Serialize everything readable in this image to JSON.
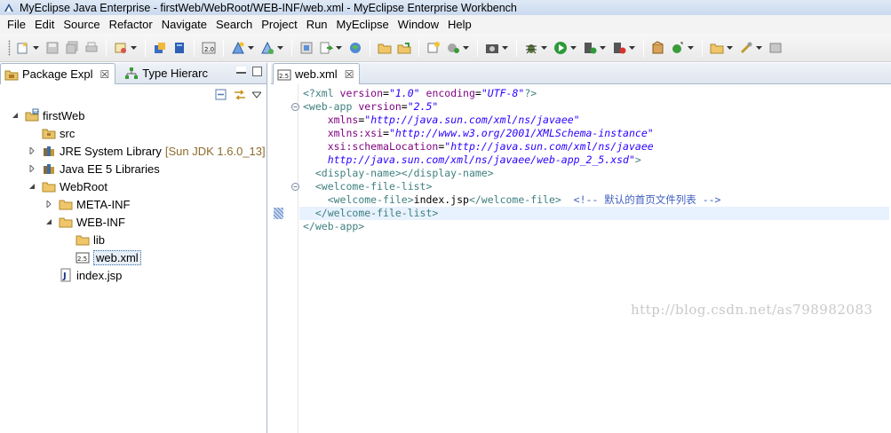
{
  "window": {
    "title": "MyEclipse Java Enterprise - firstWeb/WebRoot/WEB-INF/web.xml - MyEclipse Enterprise Workbench"
  },
  "menubar": {
    "items": [
      "File",
      "Edit",
      "Source",
      "Refactor",
      "Navigate",
      "Search",
      "Project",
      "Run",
      "MyEclipse",
      "Window",
      "Help"
    ]
  },
  "left_pane": {
    "tabs": [
      {
        "label": "Package Expl",
        "active": true
      },
      {
        "label": "Type Hierarc",
        "active": false
      }
    ],
    "close_glyph": "☒",
    "tree": [
      {
        "label": "firstWeb",
        "icon": "project-icon",
        "expanded": true
      },
      {
        "label": "src",
        "icon": "source-folder-icon"
      },
      {
        "label": "JRE System Library",
        "decoration": "[Sun JDK 1.6.0_13]",
        "icon": "library-icon",
        "expanded": false
      },
      {
        "label": "Java EE 5 Libraries",
        "icon": "library-icon",
        "expanded": false
      },
      {
        "label": "WebRoot",
        "icon": "folder-icon",
        "expanded": true
      },
      {
        "label": "META-INF",
        "icon": "folder-icon",
        "expanded": false
      },
      {
        "label": "WEB-INF",
        "icon": "folder-icon",
        "expanded": true
      },
      {
        "label": "lib",
        "icon": "folder-icon"
      },
      {
        "label": "web.xml",
        "icon": "xml-file-icon",
        "selected": true
      },
      {
        "label": "index.jsp",
        "icon": "jsp-file-icon"
      }
    ]
  },
  "editor": {
    "tab_label": "web.xml",
    "lines": [
      {
        "parts": [
          [
            "pi",
            "<?xml "
          ],
          [
            "attr",
            "version"
          ],
          [
            "text",
            "="
          ],
          [
            "val",
            "\"1.0\""
          ],
          [
            "text",
            " "
          ],
          [
            "attr",
            "encoding"
          ],
          [
            "text",
            "="
          ],
          [
            "val",
            "\"UTF-8\""
          ],
          [
            "pi",
            "?>"
          ]
        ]
      },
      {
        "parts": [
          [
            "tag",
            "<web-app "
          ],
          [
            "attr",
            "version"
          ],
          [
            "text",
            "="
          ],
          [
            "val",
            "\"2.5\""
          ]
        ]
      },
      {
        "parts": [
          [
            "text",
            "    "
          ],
          [
            "attr",
            "xmlns"
          ],
          [
            "text",
            "="
          ],
          [
            "val",
            "\"http://java.sun.com/xml/ns/javaee\""
          ]
        ]
      },
      {
        "parts": [
          [
            "text",
            "    "
          ],
          [
            "attr",
            "xmlns:xsi"
          ],
          [
            "text",
            "="
          ],
          [
            "val",
            "\"http://www.w3.org/2001/XMLSchema-instance\""
          ]
        ]
      },
      {
        "parts": [
          [
            "text",
            "    "
          ],
          [
            "attr",
            "xsi:schemaLocation"
          ],
          [
            "text",
            "="
          ],
          [
            "val",
            "\"http://java.sun.com/xml/ns/javaee"
          ]
        ]
      },
      {
        "parts": [
          [
            "text",
            "    "
          ],
          [
            "val",
            "http://java.sun.com/xml/ns/javaee/web-app_2_5.xsd\""
          ],
          [
            "tag",
            ">"
          ]
        ]
      },
      {
        "parts": [
          [
            "text",
            "  "
          ],
          [
            "tag",
            "<display-name></display-name>"
          ]
        ]
      },
      {
        "parts": [
          [
            "text",
            "  "
          ],
          [
            "tag",
            "<welcome-file-list>"
          ]
        ]
      },
      {
        "parts": [
          [
            "text",
            "    "
          ],
          [
            "tag",
            "<welcome-file>"
          ],
          [
            "text",
            "index.jsp"
          ],
          [
            "tag",
            "</welcome-file>"
          ],
          [
            "text",
            "  "
          ],
          [
            "comment",
            "<!-- 默认的首页文件列表 -->"
          ]
        ]
      },
      {
        "parts": [
          [
            "text",
            "  "
          ],
          [
            "tag",
            "</welcome-file-list>"
          ]
        ],
        "current": true
      },
      {
        "parts": [
          [
            "tag",
            "</web-app>"
          ]
        ]
      }
    ],
    "watermark": "http://blog.csdn.net/as798982083"
  }
}
